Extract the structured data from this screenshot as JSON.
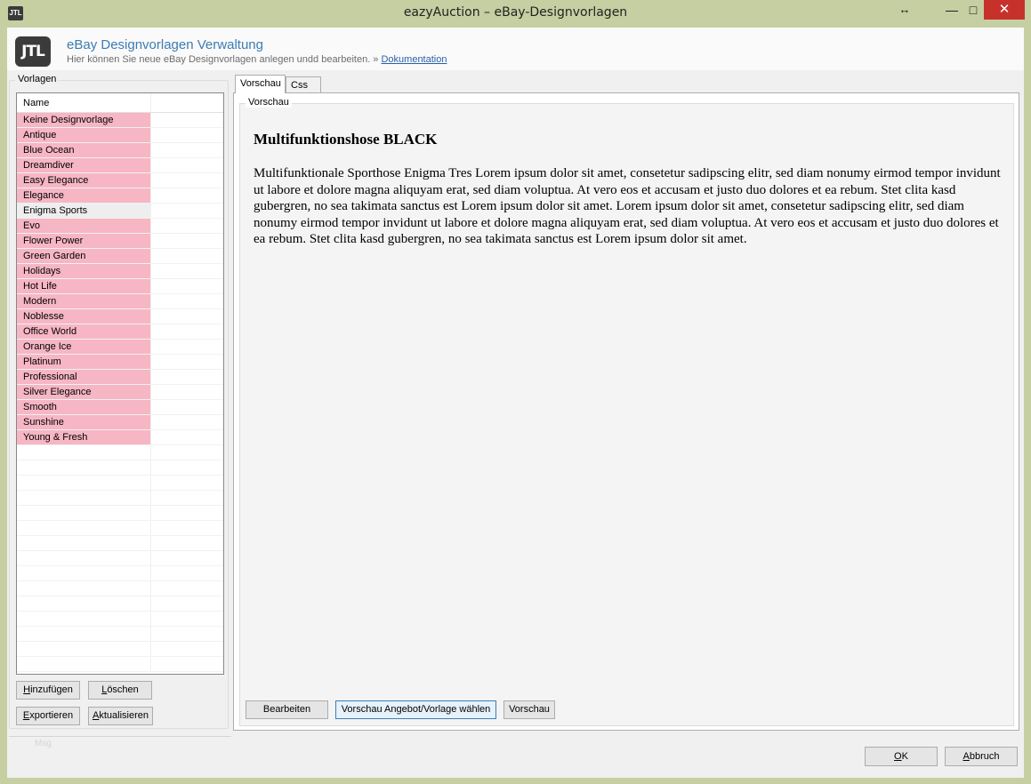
{
  "window": {
    "app_icon_text": "JTL",
    "title": "eazyAuction – eBay-Designvorlagen",
    "resize_glyph": "↔",
    "minimize_glyph": "—",
    "maximize_glyph": "□",
    "close_glyph": "✕"
  },
  "header": {
    "logo_text": "JTL",
    "title": "eBay Designvorlagen Verwaltung",
    "subtitle": "Hier können Sie neue eBay Designvorlagen anlegen undd bearbeiten. »",
    "doc_link": "Dokumentation"
  },
  "templates": {
    "group_label": "Vorlagen",
    "column_name": "Name",
    "items": [
      "Keine Designvorlage",
      "Antique",
      "Blue Ocean",
      "Dreamdiver",
      "Easy Elegance",
      "Elegance",
      "Enigma Sports",
      "Evo",
      "Flower Power",
      "Green Garden",
      "Holidays",
      "Hot Life",
      "Modern",
      "Noblesse",
      "Office World",
      "Orange Ice",
      "Platinum",
      "Professional",
      "Silver Elegance",
      "Smooth",
      "Sunshine",
      "Young & Fresh"
    ],
    "selected": "Enigma Sports",
    "highlight_color": "#f7b6c4"
  },
  "left_buttons": {
    "add_accel": "H",
    "add_rest": "inzufügen",
    "delete_accel": "L",
    "delete_rest": "öschen",
    "export_accel": "E",
    "export_rest": "xportieren",
    "refresh_accel": "A",
    "refresh_rest": "ktualisieren"
  },
  "tabs": {
    "preview": "Vorschau",
    "css": "Css",
    "active": "Vorschau"
  },
  "preview": {
    "group_label": "Vorschau",
    "heading": "Multifunktionshose BLACK",
    "body": "Multifunktionale Sporthose Enigma Tres Lorem ipsum dolor sit amet, consetetur sadipscing elitr, sed diam nonumy eirmod tempor invidunt ut labore et dolore magna aliquyam erat, sed diam voluptua. At vero eos et accusam et justo duo dolores et ea rebum. Stet clita kasd gubergren, no sea takimata sanctus est Lorem ipsum dolor sit amet. Lorem ipsum dolor sit amet, consetetur sadipscing elitr, sed diam nonumy eirmod tempor invidunt ut labore et dolore magna aliquyam erat, sed diam voluptua. At vero eos et accusam et justo duo dolores et ea rebum. Stet clita kasd gubergren, no sea takimata sanctus est Lorem ipsum dolor sit amet."
  },
  "preview_buttons": {
    "edit": "Bearbeiten",
    "choose": "Vorschau Angebot/Vorlage wählen",
    "preview": "Vorschau"
  },
  "status": {
    "text": "Msg"
  },
  "dialog_buttons": {
    "ok_accel": "O",
    "ok_rest": "K",
    "cancel_accel": "A",
    "cancel_rest": "bbruch"
  }
}
